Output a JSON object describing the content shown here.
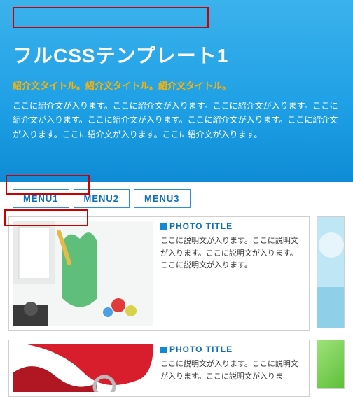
{
  "hero": {
    "site_title": "フルCSSテンプレート1",
    "intro_title": "紹介文タイトル。紹介文タイトル。紹介文タイトル。",
    "intro_text": "ここに紹介文が入ります。ここに紹介文が入ります。ここに紹介文が入ります。ここに紹介文が入ります。ここに紹介文が入ります。ここに紹介文が入ります。ここに紹介文が入ります。ここに紹介文が入ります。ここに紹介文が入ります。"
  },
  "nav": {
    "items": [
      {
        "label": "MENU1"
      },
      {
        "label": "MENU2"
      },
      {
        "label": "MENU3"
      }
    ]
  },
  "cards": [
    {
      "title": "PHOTO TITLE",
      "desc": "ここに説明文が入ります。ここに説明文が入ります。ここに説明文が入ります。ここに説明文が入ります。"
    },
    {
      "title": "PHOTO TITLE",
      "desc": "ここに説明文が入ります。ここに説明文が入ります。ここに説明文が入りま"
    }
  ]
}
